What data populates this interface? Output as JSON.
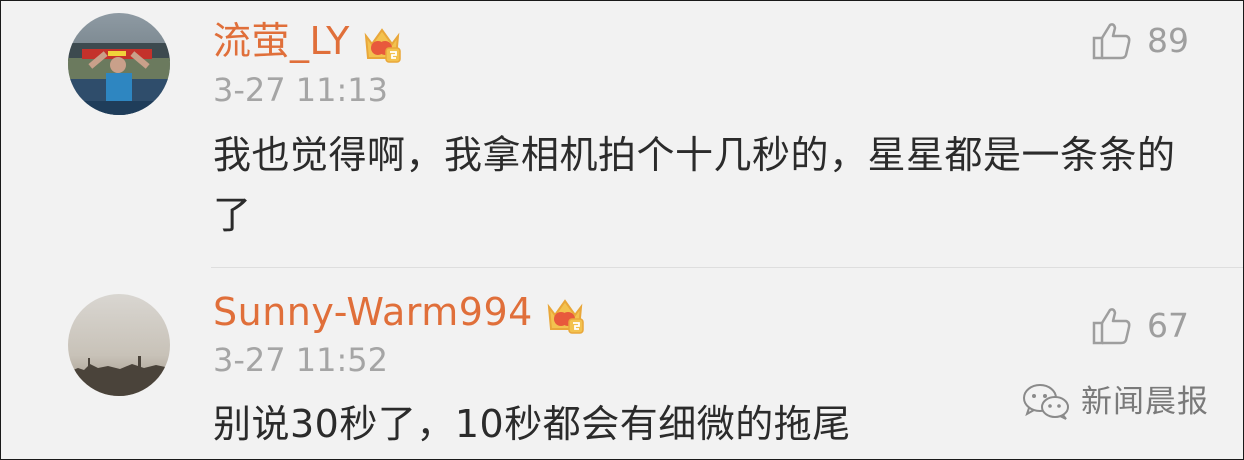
{
  "comments": [
    {
      "username": "流萤_LY",
      "timestamp": "3-27 11:13",
      "text": "我也觉得啊，我拿相机拍个十几秒的，星星都是一条条的了",
      "likes": "89",
      "badge_icon": "crown-badge-icon"
    },
    {
      "username": "Sunny-Warm994",
      "timestamp": "3-27 11:52",
      "text": "别说30秒了，10秒都会有细微的拖尾",
      "likes": "67",
      "badge_icon": "crown-badge-icon"
    }
  ],
  "watermark": {
    "text": "新闻晨报",
    "icon": "wechat-icon"
  },
  "colors": {
    "username": "#e06f3a",
    "timestamp": "#a5a5a5",
    "body_text": "#2b2b2b",
    "like": "#9e9e9e",
    "background": "#f2f2f2",
    "crown": "#f3c24f"
  }
}
